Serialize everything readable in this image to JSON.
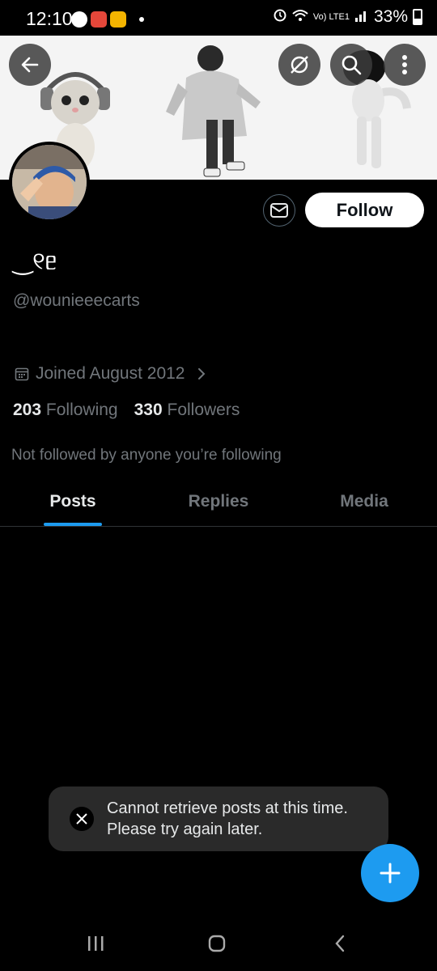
{
  "status_bar": {
    "time": "12:10",
    "network": "Vo) LTE1",
    "battery": "33%"
  },
  "profile": {
    "display_name": "‿୧ᥱ",
    "handle": "@wounieeecarts",
    "joined": "Joined August 2012",
    "following_count": "203",
    "following_label": "Following",
    "followers_count": "330",
    "followers_label": "Followers",
    "not_followed_text": "Not followed by anyone you’re following"
  },
  "actions": {
    "follow_label": "Follow"
  },
  "tabs": [
    {
      "label": "Posts",
      "active": true
    },
    {
      "label": "Replies",
      "active": false
    },
    {
      "label": "Media",
      "active": false
    }
  ],
  "toast": {
    "message": "Cannot retrieve posts at this time. Please try again later."
  },
  "colors": {
    "accent": "#1d9bf0",
    "background": "#000000",
    "secondary_text": "#71767b"
  }
}
